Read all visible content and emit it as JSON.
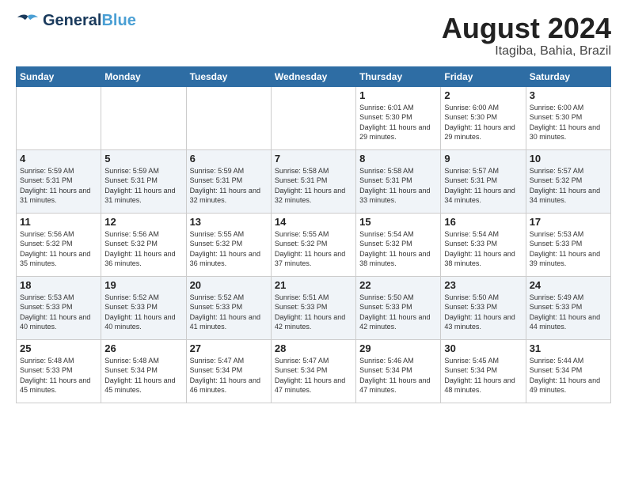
{
  "logo": {
    "text_general": "General",
    "text_blue": "Blue"
  },
  "header": {
    "month_year": "August 2024",
    "location": "Itagiba, Bahia, Brazil"
  },
  "days_of_week": [
    "Sunday",
    "Monday",
    "Tuesday",
    "Wednesday",
    "Thursday",
    "Friday",
    "Saturday"
  ],
  "weeks": [
    [
      {
        "day": "",
        "info": ""
      },
      {
        "day": "",
        "info": ""
      },
      {
        "day": "",
        "info": ""
      },
      {
        "day": "",
        "info": ""
      },
      {
        "day": "1",
        "info": "Sunrise: 6:01 AM\nSunset: 5:30 PM\nDaylight: 11 hours\nand 29 minutes."
      },
      {
        "day": "2",
        "info": "Sunrise: 6:00 AM\nSunset: 5:30 PM\nDaylight: 11 hours\nand 29 minutes."
      },
      {
        "day": "3",
        "info": "Sunrise: 6:00 AM\nSunset: 5:30 PM\nDaylight: 11 hours\nand 30 minutes."
      }
    ],
    [
      {
        "day": "4",
        "info": "Sunrise: 5:59 AM\nSunset: 5:31 PM\nDaylight: 11 hours\nand 31 minutes."
      },
      {
        "day": "5",
        "info": "Sunrise: 5:59 AM\nSunset: 5:31 PM\nDaylight: 11 hours\nand 31 minutes."
      },
      {
        "day": "6",
        "info": "Sunrise: 5:59 AM\nSunset: 5:31 PM\nDaylight: 11 hours\nand 32 minutes."
      },
      {
        "day": "7",
        "info": "Sunrise: 5:58 AM\nSunset: 5:31 PM\nDaylight: 11 hours\nand 32 minutes."
      },
      {
        "day": "8",
        "info": "Sunrise: 5:58 AM\nSunset: 5:31 PM\nDaylight: 11 hours\nand 33 minutes."
      },
      {
        "day": "9",
        "info": "Sunrise: 5:57 AM\nSunset: 5:31 PM\nDaylight: 11 hours\nand 34 minutes."
      },
      {
        "day": "10",
        "info": "Sunrise: 5:57 AM\nSunset: 5:32 PM\nDaylight: 11 hours\nand 34 minutes."
      }
    ],
    [
      {
        "day": "11",
        "info": "Sunrise: 5:56 AM\nSunset: 5:32 PM\nDaylight: 11 hours\nand 35 minutes."
      },
      {
        "day": "12",
        "info": "Sunrise: 5:56 AM\nSunset: 5:32 PM\nDaylight: 11 hours\nand 36 minutes."
      },
      {
        "day": "13",
        "info": "Sunrise: 5:55 AM\nSunset: 5:32 PM\nDaylight: 11 hours\nand 36 minutes."
      },
      {
        "day": "14",
        "info": "Sunrise: 5:55 AM\nSunset: 5:32 PM\nDaylight: 11 hours\nand 37 minutes."
      },
      {
        "day": "15",
        "info": "Sunrise: 5:54 AM\nSunset: 5:32 PM\nDaylight: 11 hours\nand 38 minutes."
      },
      {
        "day": "16",
        "info": "Sunrise: 5:54 AM\nSunset: 5:33 PM\nDaylight: 11 hours\nand 38 minutes."
      },
      {
        "day": "17",
        "info": "Sunrise: 5:53 AM\nSunset: 5:33 PM\nDaylight: 11 hours\nand 39 minutes."
      }
    ],
    [
      {
        "day": "18",
        "info": "Sunrise: 5:53 AM\nSunset: 5:33 PM\nDaylight: 11 hours\nand 40 minutes."
      },
      {
        "day": "19",
        "info": "Sunrise: 5:52 AM\nSunset: 5:33 PM\nDaylight: 11 hours\nand 40 minutes."
      },
      {
        "day": "20",
        "info": "Sunrise: 5:52 AM\nSunset: 5:33 PM\nDaylight: 11 hours\nand 41 minutes."
      },
      {
        "day": "21",
        "info": "Sunrise: 5:51 AM\nSunset: 5:33 PM\nDaylight: 11 hours\nand 42 minutes."
      },
      {
        "day": "22",
        "info": "Sunrise: 5:50 AM\nSunset: 5:33 PM\nDaylight: 11 hours\nand 42 minutes."
      },
      {
        "day": "23",
        "info": "Sunrise: 5:50 AM\nSunset: 5:33 PM\nDaylight: 11 hours\nand 43 minutes."
      },
      {
        "day": "24",
        "info": "Sunrise: 5:49 AM\nSunset: 5:33 PM\nDaylight: 11 hours\nand 44 minutes."
      }
    ],
    [
      {
        "day": "25",
        "info": "Sunrise: 5:48 AM\nSunset: 5:33 PM\nDaylight: 11 hours\nand 45 minutes."
      },
      {
        "day": "26",
        "info": "Sunrise: 5:48 AM\nSunset: 5:34 PM\nDaylight: 11 hours\nand 45 minutes."
      },
      {
        "day": "27",
        "info": "Sunrise: 5:47 AM\nSunset: 5:34 PM\nDaylight: 11 hours\nand 46 minutes."
      },
      {
        "day": "28",
        "info": "Sunrise: 5:47 AM\nSunset: 5:34 PM\nDaylight: 11 hours\nand 47 minutes."
      },
      {
        "day": "29",
        "info": "Sunrise: 5:46 AM\nSunset: 5:34 PM\nDaylight: 11 hours\nand 47 minutes."
      },
      {
        "day": "30",
        "info": "Sunrise: 5:45 AM\nSunset: 5:34 PM\nDaylight: 11 hours\nand 48 minutes."
      },
      {
        "day": "31",
        "info": "Sunrise: 5:44 AM\nSunset: 5:34 PM\nDaylight: 11 hours\nand 49 minutes."
      }
    ]
  ]
}
